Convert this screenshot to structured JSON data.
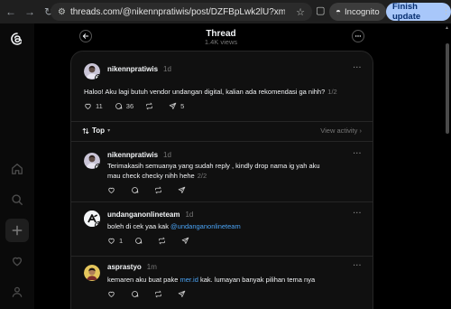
{
  "browser": {
    "url": "threads.com/@nikennpratiwis/post/DZFBpLwk2lU?xmt=AQG0dO7d...",
    "incognito_label": "Incognito",
    "update_label": "Finish update"
  },
  "header": {
    "title": "Thread",
    "views": "1.4K views"
  },
  "main_post": {
    "username": "nikennpratiwis",
    "time": "1d",
    "text": "Haloo! Aku lagi butuh vendor undangan digital, kalian ada rekomendasi ga nihh?",
    "counter": "1/2",
    "likes": "11",
    "replies": "36",
    "reposts": "",
    "shares": "5"
  },
  "sort": {
    "label": "Top",
    "view_activity": "View activity"
  },
  "replies": [
    {
      "username": "nikennpratiwis",
      "time": "1d",
      "text": "Terimakasih semuanya yang sudah reply , kindly drop nama ig yah aku mau check checky nihh hehe",
      "counter": "2/2",
      "likes": "",
      "replies": "",
      "reposts": "",
      "shares": ""
    },
    {
      "username": "undanganonlineteam",
      "time": "1d",
      "text_before": "boleh di cek yaa kak ",
      "mention": "@undanganonlineteam",
      "likes": "1",
      "replies": "",
      "reposts": "",
      "shares": ""
    },
    {
      "username": "asprastyo",
      "time": "1m",
      "text_before": "kemaren aku buat pake ",
      "mention": "mer.id",
      "text_after": " kak. lumayan banyak pilihan tema nya",
      "likes": "",
      "replies": "",
      "reposts": "",
      "shares": ""
    }
  ],
  "colors": {
    "accent_blue": "#a8c7fa",
    "mention": "#4aa3f5",
    "background": "#101010"
  }
}
